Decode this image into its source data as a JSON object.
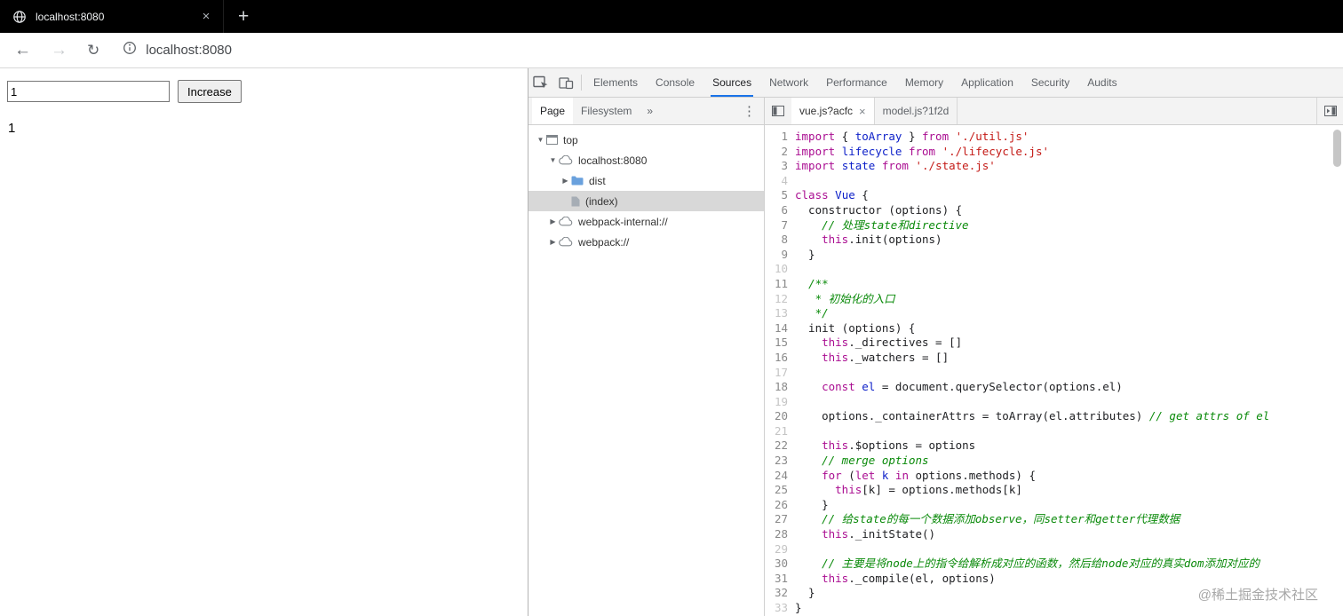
{
  "icons": {
    "tab_close": "×",
    "new_tab": "+",
    "back": "←",
    "forward": "→",
    "refresh": "↻",
    "overflow_chevrons": "»",
    "more_menu": "⋮",
    "expanded_arrow": "▼",
    "collapsed_arrow": "▶"
  },
  "browser": {
    "tab_title": "localhost:8080",
    "address": "localhost:8080"
  },
  "page": {
    "input_value": "1",
    "increase_label": "Increase",
    "counter": "1"
  },
  "devtools": {
    "main_tabs": [
      "Elements",
      "Console",
      "Sources",
      "Network",
      "Performance",
      "Memory",
      "Application",
      "Security",
      "Audits"
    ],
    "active_main_tab": "Sources",
    "navigator": {
      "tabs": [
        "Page",
        "Filesystem"
      ],
      "active_tab": "Page",
      "tree": [
        {
          "label": "top",
          "icon": "frame",
          "state": "expanded",
          "depth": 0,
          "selected": false
        },
        {
          "label": "localhost:8080",
          "icon": "cloud",
          "state": "expanded",
          "depth": 1,
          "selected": false
        },
        {
          "label": "dist",
          "icon": "folder",
          "state": "collapsed",
          "depth": 2,
          "selected": false
        },
        {
          "label": "(index)",
          "icon": "file",
          "state": "none",
          "depth": 2,
          "selected": true
        },
        {
          "label": "webpack-internal://",
          "icon": "cloud",
          "state": "collapsed",
          "depth": 1,
          "selected": false
        },
        {
          "label": "webpack://",
          "icon": "cloud",
          "state": "collapsed",
          "depth": 1,
          "selected": false
        }
      ]
    },
    "editor": {
      "tabs": [
        {
          "label": "vue.js?acfc",
          "active": true,
          "closable": true
        },
        {
          "label": "model.js?1f2d",
          "active": false,
          "closable": false
        }
      ],
      "code": [
        {
          "n": 1,
          "dim": false,
          "t": [
            [
              "k",
              "import"
            ],
            [
              "p",
              " { "
            ],
            [
              "d",
              "toArray"
            ],
            [
              "p",
              " } "
            ],
            [
              "k",
              "from"
            ],
            [
              "p",
              " "
            ],
            [
              "s",
              "'./util.js'"
            ]
          ]
        },
        {
          "n": 2,
          "dim": false,
          "t": [
            [
              "k",
              "import"
            ],
            [
              "p",
              " "
            ],
            [
              "d",
              "lifecycle"
            ],
            [
              "p",
              " "
            ],
            [
              "k",
              "from"
            ],
            [
              "p",
              " "
            ],
            [
              "s",
              "'./lifecycle.js'"
            ]
          ]
        },
        {
          "n": 3,
          "dim": false,
          "t": [
            [
              "k",
              "import"
            ],
            [
              "p",
              " "
            ],
            [
              "d",
              "state"
            ],
            [
              "p",
              " "
            ],
            [
              "k",
              "from"
            ],
            [
              "p",
              " "
            ],
            [
              "s",
              "'./state.js'"
            ]
          ]
        },
        {
          "n": 4,
          "dim": true,
          "t": []
        },
        {
          "n": 5,
          "dim": false,
          "t": [
            [
              "k",
              "class"
            ],
            [
              "p",
              " "
            ],
            [
              "d",
              "Vue"
            ],
            [
              "p",
              " {"
            ]
          ]
        },
        {
          "n": 6,
          "dim": false,
          "t": [
            [
              "p",
              "  constructor (options) {"
            ]
          ]
        },
        {
          "n": 7,
          "dim": false,
          "t": [
            [
              "p",
              "    "
            ],
            [
              "c",
              "// 处理state和directive"
            ]
          ]
        },
        {
          "n": 8,
          "dim": false,
          "t": [
            [
              "p",
              "    "
            ],
            [
              "k",
              "this"
            ],
            [
              "p",
              ".init(options)"
            ]
          ]
        },
        {
          "n": 9,
          "dim": false,
          "t": [
            [
              "p",
              "  }"
            ]
          ]
        },
        {
          "n": 10,
          "dim": true,
          "t": []
        },
        {
          "n": 11,
          "dim": false,
          "t": [
            [
              "p",
              "  "
            ],
            [
              "c",
              "/**"
            ]
          ]
        },
        {
          "n": 12,
          "dim": true,
          "t": [
            [
              "p",
              "   "
            ],
            [
              "c",
              "* 初始化的入口"
            ]
          ]
        },
        {
          "n": 13,
          "dim": true,
          "t": [
            [
              "p",
              "   "
            ],
            [
              "c",
              "*/"
            ]
          ]
        },
        {
          "n": 14,
          "dim": false,
          "t": [
            [
              "p",
              "  init (options) {"
            ]
          ]
        },
        {
          "n": 15,
          "dim": false,
          "t": [
            [
              "p",
              "    "
            ],
            [
              "k",
              "this"
            ],
            [
              "p",
              "._directives = []"
            ]
          ]
        },
        {
          "n": 16,
          "dim": false,
          "t": [
            [
              "p",
              "    "
            ],
            [
              "k",
              "this"
            ],
            [
              "p",
              "._watchers = []"
            ]
          ]
        },
        {
          "n": 17,
          "dim": true,
          "t": []
        },
        {
          "n": 18,
          "dim": false,
          "t": [
            [
              "p",
              "    "
            ],
            [
              "k",
              "const"
            ],
            [
              "p",
              " "
            ],
            [
              "d",
              "el"
            ],
            [
              "p",
              " = document.querySelector(options.el)"
            ]
          ]
        },
        {
          "n": 19,
          "dim": true,
          "t": []
        },
        {
          "n": 20,
          "dim": false,
          "t": [
            [
              "p",
              "    options._containerAttrs = toArray(el.attributes) "
            ],
            [
              "c",
              "// get attrs of el"
            ]
          ]
        },
        {
          "n": 21,
          "dim": true,
          "t": []
        },
        {
          "n": 22,
          "dim": false,
          "t": [
            [
              "p",
              "    "
            ],
            [
              "k",
              "this"
            ],
            [
              "p",
              ".$options = options"
            ]
          ]
        },
        {
          "n": 23,
          "dim": false,
          "t": [
            [
              "p",
              "    "
            ],
            [
              "c",
              "// merge options"
            ]
          ]
        },
        {
          "n": 24,
          "dim": false,
          "t": [
            [
              "p",
              "    "
            ],
            [
              "k",
              "for"
            ],
            [
              "p",
              " ("
            ],
            [
              "k",
              "let"
            ],
            [
              "p",
              " "
            ],
            [
              "d",
              "k"
            ],
            [
              "p",
              " "
            ],
            [
              "k",
              "in"
            ],
            [
              "p",
              " options.methods) {"
            ]
          ]
        },
        {
          "n": 25,
          "dim": false,
          "t": [
            [
              "p",
              "      "
            ],
            [
              "k",
              "this"
            ],
            [
              "p",
              "[k] = options.methods[k]"
            ]
          ]
        },
        {
          "n": 26,
          "dim": false,
          "t": [
            [
              "p",
              "    }"
            ]
          ]
        },
        {
          "n": 27,
          "dim": false,
          "t": [
            [
              "p",
              "    "
            ],
            [
              "c",
              "// 给state的每一个数据添加observe，同setter和getter代理数据"
            ]
          ]
        },
        {
          "n": 28,
          "dim": false,
          "t": [
            [
              "p",
              "    "
            ],
            [
              "k",
              "this"
            ],
            [
              "p",
              "._initState()"
            ]
          ]
        },
        {
          "n": 29,
          "dim": true,
          "t": []
        },
        {
          "n": 30,
          "dim": false,
          "t": [
            [
              "p",
              "    "
            ],
            [
              "c",
              "// 主要是将node上的指令给解析成对应的函数，然后给node对应的真实dom添加对应的"
            ]
          ]
        },
        {
          "n": 31,
          "dim": false,
          "t": [
            [
              "p",
              "    "
            ],
            [
              "k",
              "this"
            ],
            [
              "p",
              "._compile(el, options)"
            ]
          ]
        },
        {
          "n": 32,
          "dim": false,
          "t": [
            [
              "p",
              "  }"
            ]
          ]
        },
        {
          "n": 33,
          "dim": true,
          "t": [
            [
              "p",
              "}"
            ]
          ]
        }
      ]
    }
  },
  "watermark": "@稀土掘金技术社区"
}
